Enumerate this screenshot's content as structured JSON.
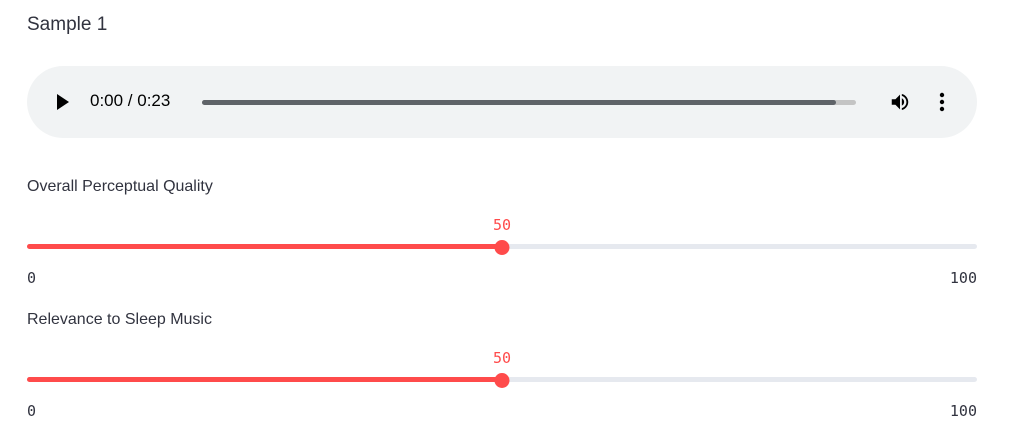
{
  "sample": {
    "title": "Sample 1"
  },
  "audio": {
    "time_display": "0:00 / 0:23",
    "buffered_fraction": 1.0,
    "icons": {
      "play": "play-icon",
      "volume": "volume-icon",
      "more": "more-vert-icon"
    }
  },
  "sliders": [
    {
      "label": "Overall Perceptual Quality",
      "value": "50",
      "min": "0",
      "max": "100"
    },
    {
      "label": "Relevance to Sleep Music",
      "value": "50",
      "min": "0",
      "max": "100"
    }
  ],
  "colors": {
    "accent": "#ff4b4b",
    "rail": "#e6e9ef",
    "player_bg": "#f1f3f4"
  }
}
